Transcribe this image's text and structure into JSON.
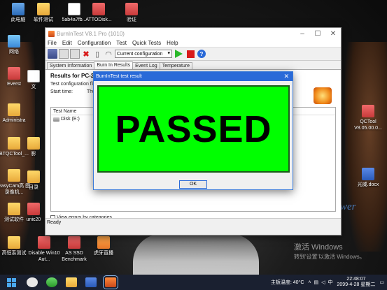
{
  "desktop": {
    "icons": [
      {
        "label": "此电脑",
        "icon": "computer-icon"
      },
      {
        "label": "软件测试",
        "icon": "folder-icon"
      },
      {
        "label": "5ab4a7fb...",
        "icon": "document-icon"
      },
      {
        "label": "ATTODisk...",
        "icon": "app-icon"
      },
      {
        "label": "验证",
        "icon": "app-icon"
      },
      {
        "label": "网络",
        "icon": "network-icon"
      },
      {
        "label": "Everst",
        "icon": "app-icon"
      },
      {
        "label": "Administra",
        "icon": "folder-icon"
      },
      {
        "label": "BTQCTool_...",
        "icon": "folder-icon"
      },
      {
        "label": "EasyCam高\n图录像机...",
        "icon": "folder-icon"
      },
      {
        "label": "测试软件",
        "icon": "folder-icon"
      },
      {
        "label": "高恒系测试",
        "icon": "folder-icon"
      },
      {
        "label": "Disable\nWin10 Aut...",
        "icon": "app-icon"
      },
      {
        "label": "AS SSD\nBenchmark",
        "icon": "app-icon"
      },
      {
        "label": "虎牙直播",
        "icon": "app-icon"
      },
      {
        "label": "QCTool\nV8.05.00.0...",
        "icon": "app-icon"
      },
      {
        "label": "光威.docx",
        "icon": "word-icon"
      },
      {
        "label": "文",
        "icon": "document-icon"
      },
      {
        "label": "影",
        "icon": "folder-icon"
      },
      {
        "label": "目录",
        "icon": "folder-icon"
      },
      {
        "label": "unic20",
        "icon": "app-icon"
      }
    ],
    "watermark_line1": "激活 Windows",
    "watermark_line2": "转到'设置'以激活 Windows。",
    "partial_text": "wer"
  },
  "window": {
    "title": "BurnInTest V8.1 Pro (1010)",
    "menu": [
      "File",
      "Edit",
      "Configuration",
      "Test",
      "Quick Tests",
      "Help"
    ],
    "config_value": "Current configuration",
    "tabs": [
      "System Information",
      "Burn In Results",
      "Event Log",
      "Temperature"
    ],
    "results_title": "Results for PC-201...",
    "config_file_label": "Test configuration fil...",
    "start_time_label": "Start time:",
    "start_time_value": "Thu...",
    "list_header": "Test Name",
    "list_row": "Disk (E:)",
    "view_errors_label": "View errors by categories",
    "status": "Ready"
  },
  "dialog": {
    "title": "BurnInTest test result",
    "result_text": "PASSED",
    "ok_label": "OK",
    "result_color": "#00ff00"
  },
  "taskbar": {
    "cpu_temp": "主板温度: 40°C",
    "time": "22:48:07",
    "date": "2099-4-28 星期二"
  }
}
